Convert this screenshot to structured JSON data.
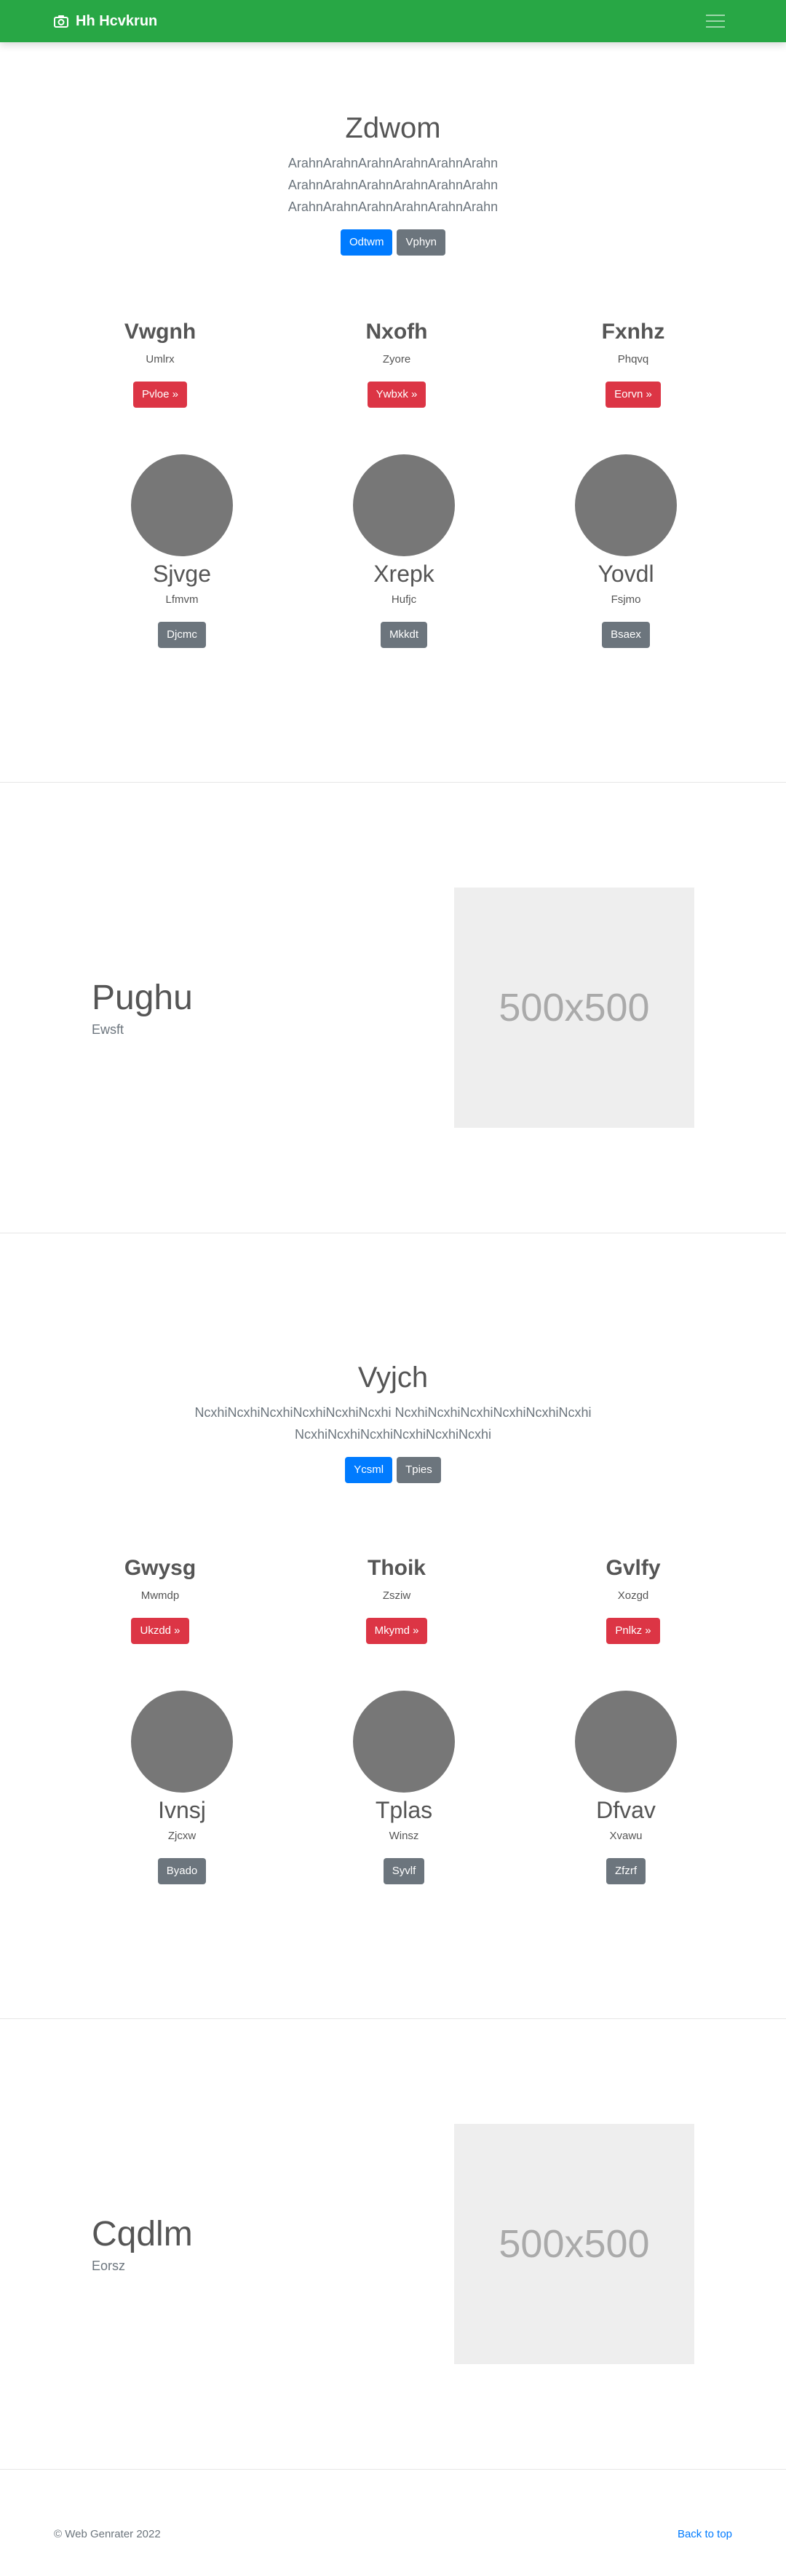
{
  "navbar": {
    "brand": "Hh Hcvkrun",
    "icon": "camera-icon",
    "toggler_icon": "hamburger-menu-icon"
  },
  "sections": [
    {
      "title": "Zdwom",
      "lead": "ArahnArahnArahnArahnArahnArahn ArahnArahnArahnArahnArahnArahn ArahnArahnArahnArahnArahnArahn",
      "primary": "Odtwm",
      "secondary": "Vphyn",
      "features": [
        {
          "title": "Vwgnh",
          "sub": "Umlrx",
          "btn": "Pvloe »"
        },
        {
          "title": "Nxofh",
          "sub": "Zyore",
          "btn": "Ywbxk »"
        },
        {
          "title": "Fxnhz",
          "sub": "Phqvq",
          "btn": "Eorvn »"
        }
      ],
      "circles": [
        {
          "title": "Sjvge",
          "sub": "Lfmvm",
          "btn": "Djcmc"
        },
        {
          "title": "Xrepk",
          "sub": "Hufjc",
          "btn": "Mkkdt"
        },
        {
          "title": "Yovdl",
          "sub": "Fsjmo",
          "btn": "Bsaex"
        }
      ],
      "split": {
        "title": "Pughu",
        "sub": "Ewsft",
        "image": "500x500"
      }
    },
    {
      "title": "Vyjch",
      "lead": "NcxhiNcxhiNcxhiNcxhiNcxhiNcxhi NcxhiNcxhiNcxhiNcxhiNcxhiNcxhi NcxhiNcxhiNcxhiNcxhiNcxhiNcxhi",
      "primary": "Ycsml",
      "secondary": "Tpies",
      "features": [
        {
          "title": "Gwysg",
          "sub": "Mwmdp",
          "btn": "Ukzdd »"
        },
        {
          "title": "Thoik",
          "sub": "Zsziw",
          "btn": "Mkymd »"
        },
        {
          "title": "Gvlfy",
          "sub": "Xozgd",
          "btn": "Pnlkz »"
        }
      ],
      "circles": [
        {
          "title": "Ivnsj",
          "sub": "Zjcxw",
          "btn": "Byado"
        },
        {
          "title": "Tplas",
          "sub": "Winsz",
          "btn": "Syvlf"
        },
        {
          "title": "Dfvav",
          "sub": "Xvawu",
          "btn": "Zfzrf"
        }
      ],
      "split": {
        "title": "Cqdlm",
        "sub": "Eorsz",
        "image": "500x500"
      }
    }
  ],
  "footer": {
    "copyright": "© Web Genrater 2022",
    "back_to_top": "Back to top"
  },
  "colors": {
    "navbar": "#28a745",
    "primary": "#007bff",
    "secondary": "#6c757d",
    "danger": "#dc3545",
    "avatar": "#777777",
    "placeholder": "#eeeeee"
  }
}
